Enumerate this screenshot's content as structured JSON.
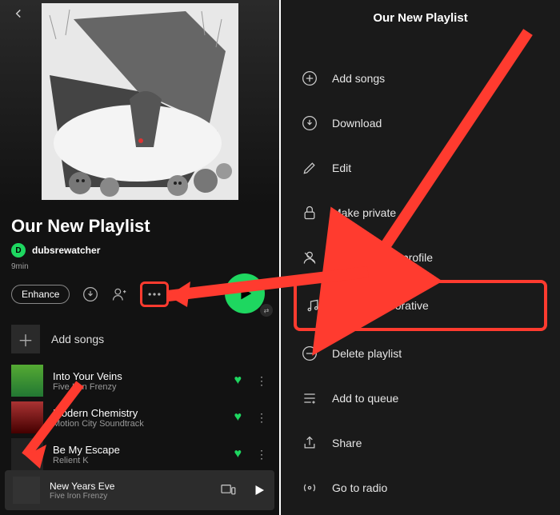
{
  "left": {
    "playlist_title": "Our New Playlist",
    "owner": "dubsrewatcher",
    "owner_initial": "D",
    "duration": "9min",
    "enhance_label": "Enhance",
    "add_songs_label": "Add songs",
    "tracks": [
      {
        "title": "Into Your Veins",
        "artist": "Five Iron Frenzy"
      },
      {
        "title": "Modern Chemistry",
        "artist": "Motion City Soundtrack"
      },
      {
        "title": "Be My Escape",
        "artist": "Relient K"
      }
    ],
    "now_playing": {
      "title": "New Years Eve",
      "artist": "Five Iron Frenzy"
    }
  },
  "right": {
    "title": "Our New Playlist",
    "items": {
      "add_songs": "Add songs",
      "download": "Download",
      "edit": "Edit",
      "make_private": "Make private",
      "remove_profile": "Remove from profile",
      "make_collab": "Make collaborative",
      "delete": "Delete playlist",
      "add_queue": "Add to queue",
      "share": "Share",
      "radio": "Go to radio"
    }
  }
}
